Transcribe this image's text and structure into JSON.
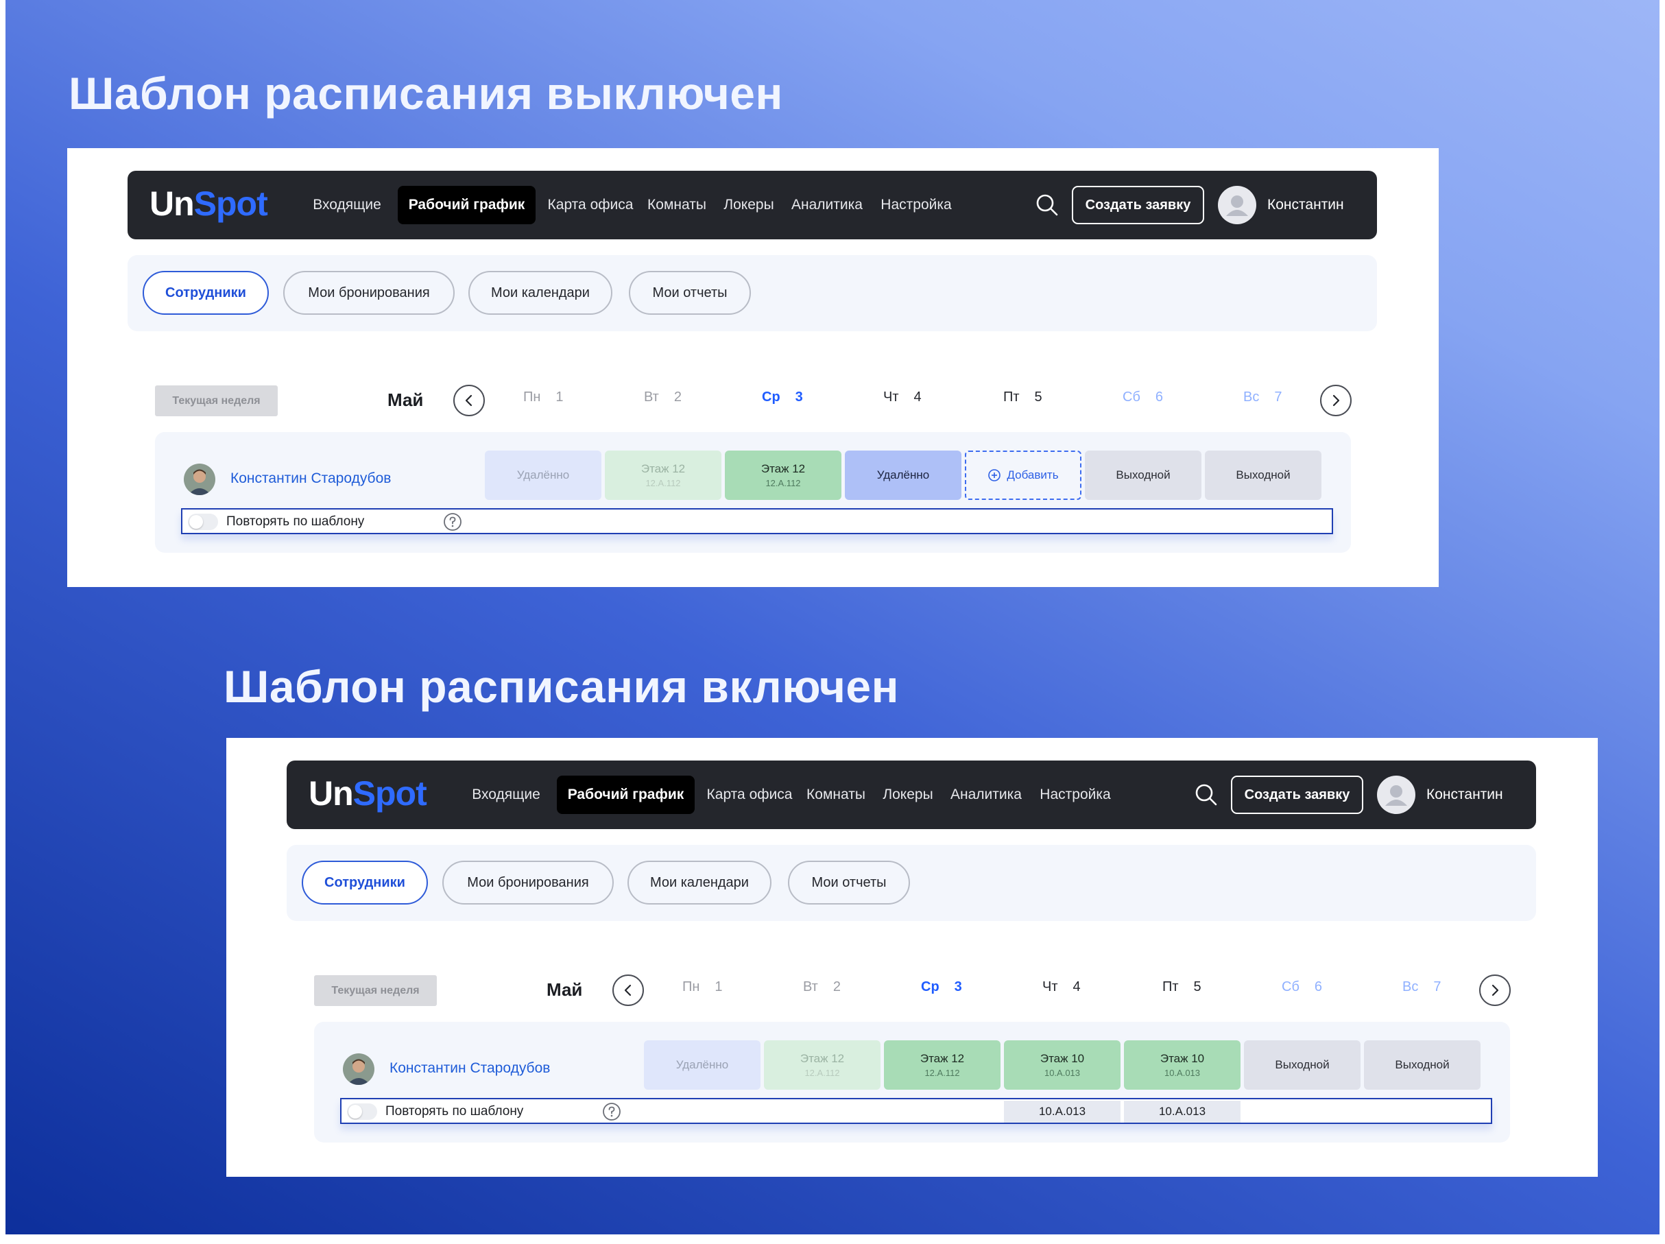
{
  "titles": {
    "off": "Шаблон расписания выключен",
    "on": "Шаблон расписания включен"
  },
  "brand": {
    "logo_part1": "Un",
    "logo_part2": "Spot",
    "accent": "#2f6bff"
  },
  "nav": {
    "items": [
      "Входящие",
      "Рабочий график",
      "Карта офиса",
      "Комнаты",
      "Локеры",
      "Аналитика",
      "Настройка"
    ],
    "active_index": 1,
    "search_icon": "search-icon",
    "create_button": "Создать заявку",
    "user_name": "Константин"
  },
  "tabs": {
    "items": [
      "Сотрудники",
      "Мои бронирования",
      "Мои календари",
      "Мои отчеты"
    ],
    "active_index": 0
  },
  "week": {
    "current_week_button": "Текущая неделя",
    "month": "Май",
    "days": [
      {
        "name": "Пн",
        "num": "1"
      },
      {
        "name": "Вт",
        "num": "2"
      },
      {
        "name": "Ср",
        "num": "3"
      },
      {
        "name": "Чт",
        "num": "4"
      },
      {
        "name": "Пт",
        "num": "5"
      },
      {
        "name": "Сб",
        "num": "6"
      },
      {
        "name": "Вс",
        "num": "7"
      }
    ]
  },
  "employee": {
    "name": "Константин Стародубов"
  },
  "template_toggle": {
    "label": "Повторять по шаблону",
    "enabled_off_panel": false,
    "enabled_on_panel": false
  },
  "schedule_off": [
    {
      "title": "Удалённо",
      "sub": ""
    },
    {
      "title": "Этаж 12",
      "sub": "12.A.112"
    },
    {
      "title": "Этаж 12",
      "sub": "12.A.112"
    },
    {
      "title": "Удалённо",
      "sub": ""
    },
    {
      "title": "Добавить",
      "sub": ""
    },
    {
      "title": "Выходной",
      "sub": ""
    },
    {
      "title": "Выходной",
      "sub": ""
    }
  ],
  "schedule_on": [
    {
      "title": "Удалённо",
      "sub": ""
    },
    {
      "title": "Этаж 12",
      "sub": "12.A.112"
    },
    {
      "title": "Этаж 12",
      "sub": "12.A.112"
    },
    {
      "title": "Этаж 10",
      "sub": "10.A.013"
    },
    {
      "title": "Этаж 10",
      "sub": "10.A.013"
    },
    {
      "title": "Выходной",
      "sub": ""
    },
    {
      "title": "Выходной",
      "sub": ""
    }
  ],
  "template_values_on": {
    "thu": "10.A.013",
    "fri": "10.A.013"
  }
}
